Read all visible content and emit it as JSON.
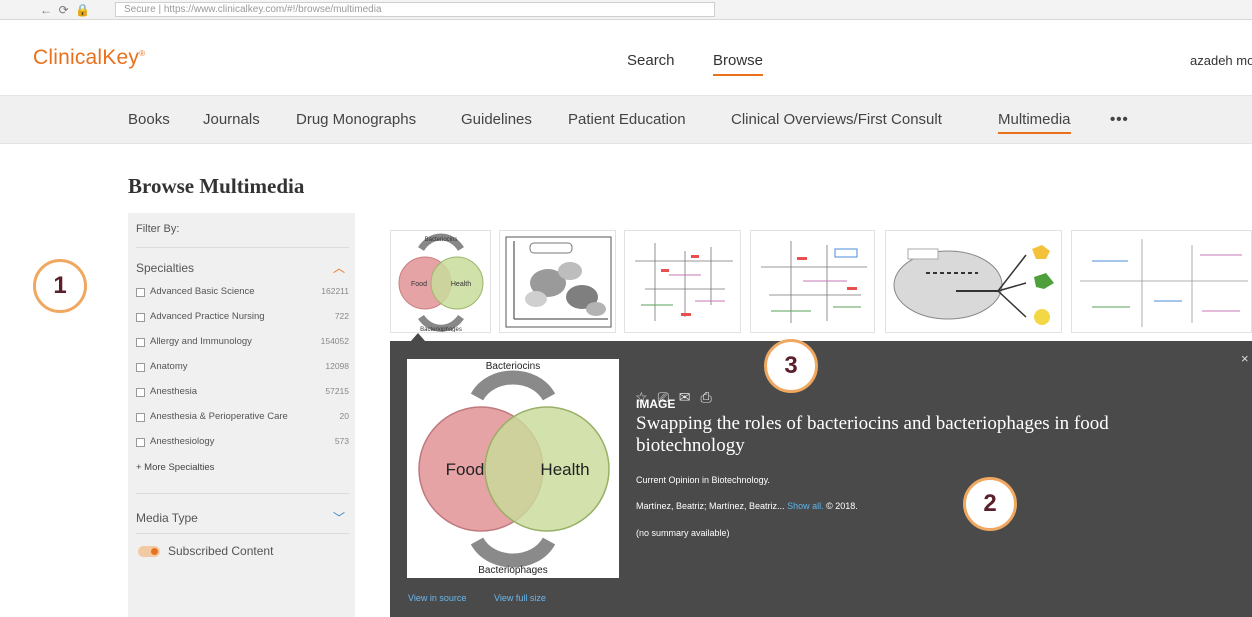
{
  "browser": {
    "url_text": "Secure  |  https://www.clinicalkey.com/#!/browse/multimedia"
  },
  "header": {
    "logo": "ClinicalKey",
    "logo_mark": "®",
    "nav": [
      "Search",
      "Browse"
    ],
    "user": "azadeh mo"
  },
  "subnav": {
    "items": [
      "Books",
      "Journals",
      "Drug Monographs",
      "Guidelines",
      "Patient Education",
      "Clinical Overviews/First Consult",
      "Multimedia"
    ],
    "more": "•••",
    "active": "Multimedia"
  },
  "page": {
    "title": "Browse Multimedia"
  },
  "sidebar": {
    "filter_label": "Filter By:",
    "specialties_heading": "Specialties",
    "specialties": [
      {
        "label": "Advanced Basic Science",
        "count": "162211"
      },
      {
        "label": "Advanced Practice Nursing",
        "count": "722"
      },
      {
        "label": "Allergy and Immunology",
        "count": "154052"
      },
      {
        "label": "Anatomy",
        "count": "12098"
      },
      {
        "label": "Anesthesia",
        "count": "57215"
      },
      {
        "label": "Anesthesia & Perioperative Care",
        "count": "20"
      },
      {
        "label": "Anesthesiology",
        "count": "573"
      }
    ],
    "more_specialties": "+ More Specialties",
    "media_type_heading": "Media Type",
    "subscribed_label": "Subscribed Content"
  },
  "detail": {
    "type": "IMAGE",
    "title": "Swapping the roles of bacteriocins and bacteriophages in food biotechnology",
    "journal": "Current Opinion in Biotechnology.",
    "authors": "Martínez, Beatriz; Martínez, Beatriz...",
    "show_all": "Show all.",
    "year": "© 2018.",
    "summary": "(no summary available)",
    "view_source": "View in source",
    "view_full": "View full size",
    "close": "×",
    "figure": {
      "top_label": "Bacteriocins",
      "left_label": "Food",
      "right_label": "Health",
      "bottom_label": "Bacteriophages"
    }
  },
  "thumb1": {
    "top_label": "Bacteriocins",
    "left_label": "Food",
    "right_label": "Health",
    "bottom_label": "Bacteriophages"
  },
  "annotations": [
    "1",
    "2",
    "3"
  ],
  "colors": {
    "brand_orange": "#e9711c",
    "panel_dark": "#4a4a4a",
    "link_blue": "#5ab4f0",
    "annotation_ring": "#f0a860",
    "annotation_text": "#5b1f2b"
  }
}
